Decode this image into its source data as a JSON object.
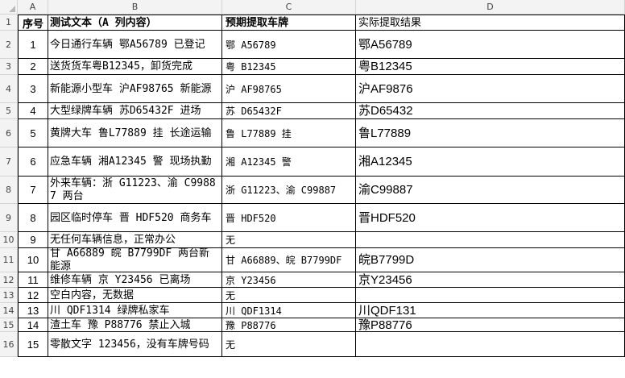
{
  "column_headers": [
    "A",
    "B",
    "C",
    "D"
  ],
  "row_numbers": [
    "1",
    "2",
    "3",
    "4",
    "5",
    "6",
    "7",
    "8",
    "9",
    "10",
    "11",
    "12",
    "13",
    "14",
    "15",
    "16"
  ],
  "header_row": {
    "a": "序号",
    "b": "测试文本（A 列内容）",
    "c": "预期提取车牌",
    "d": "实际提取结果"
  },
  "rows": [
    {
      "a": "1",
      "b": "今日通行车辆 鄂A56789 已登记",
      "c": "鄂 A56789",
      "d": "鄂A56789"
    },
    {
      "a": "2",
      "b": "送货货车粤B12345，卸货完成",
      "c": "粤 B12345",
      "d": "粤B12345"
    },
    {
      "a": "3",
      "b": "新能源小型车 沪AF98765 新能源",
      "c": "沪 AF98765",
      "d": "沪AF9876"
    },
    {
      "a": "4",
      "b": "大型绿牌车辆 苏D65432F 进场",
      "c": "苏 D65432F",
      "d": "苏D65432"
    },
    {
      "a": "5",
      "b": "黄牌大车 鲁L77889 挂 长途运输",
      "c": "鲁 L77889 挂",
      "d": "鲁L77889"
    },
    {
      "a": "6",
      "b": "应急车辆 湘A12345 警 现场执勤",
      "c": "湘 A12345 警",
      "d": "湘A12345"
    },
    {
      "a": "7",
      "b": "外来车辆：浙 G11223、渝 C99887 两台",
      "c": "浙 G11223、渝 C99887",
      "d": "渝C99887"
    },
    {
      "a": "8",
      "b": "园区临时停车 晋 HDF520 商务车",
      "c": "晋 HDF520",
      "d": "晋HDF520"
    },
    {
      "a": "9",
      "b": "无任何车辆信息，正常办公",
      "c": "无",
      "d": ""
    },
    {
      "a": "10",
      "b": "甘 A66889 皖 B7799DF 两台新能源",
      "c": "甘 A66889、皖 B7799DF",
      "d": "皖B7799D"
    },
    {
      "a": "11",
      "b": "维修车辆 京 Y23456 已离场",
      "c": "京 Y23456",
      "d": "京Y23456"
    },
    {
      "a": "12",
      "b": "空白内容，无数据",
      "c": "无",
      "d": ""
    },
    {
      "a": "13",
      "b": "川 QDF1314 绿牌私家车",
      "c": "川 QDF1314",
      "d": "川QDF131"
    },
    {
      "a": "14",
      "b": "渣土车 豫 P88776 禁止入城",
      "c": "豫 P88776",
      "d": "豫P88776"
    },
    {
      "a": "15",
      "b": "零散文字 123456，没有车牌号码",
      "c": "无",
      "d": ""
    }
  ]
}
